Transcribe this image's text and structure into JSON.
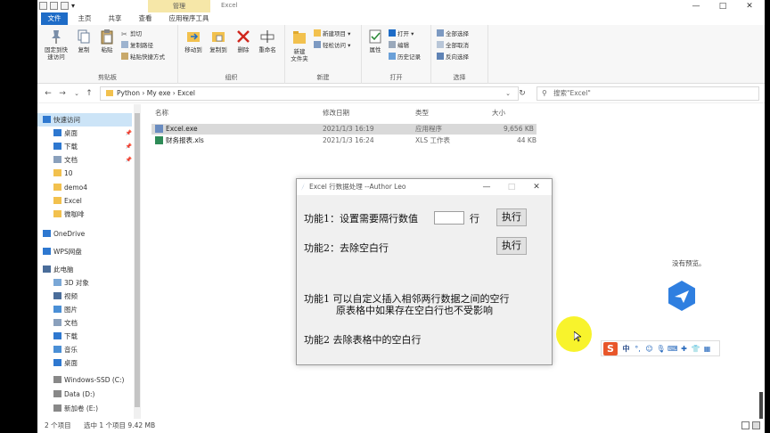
{
  "window": {
    "title": "Excel",
    "manage_tab": "管理",
    "controls": [
      "—",
      "□",
      "✕"
    ]
  },
  "ribbon_tabs": [
    {
      "label": "文件",
      "active": true
    },
    {
      "label": "主页",
      "active": false
    },
    {
      "label": "共享",
      "active": false
    },
    {
      "label": "查看",
      "active": false
    },
    {
      "label": "应用程序工具",
      "active": false
    }
  ],
  "ribbon": {
    "clipboard": {
      "label": "剪贴板",
      "pin_label": "固定到快\n速访问",
      "copy_label": "复制",
      "paste_label": "粘贴",
      "cut_label": "剪切",
      "copy_path_label": "复制路径",
      "paste_shortcut_label": "粘贴快捷方式"
    },
    "organize": {
      "label": "组织",
      "move_label": "移动到",
      "copy_to_label": "复制到",
      "delete_label": "删除",
      "rename_label": "重命名"
    },
    "new": {
      "label": "新建",
      "new_folder_label": "新建\n文件夹",
      "new_item_label": "新建项目",
      "easy_access_label": "轻松访问"
    },
    "open": {
      "label": "打开",
      "properties_label": "属性",
      "open_label": "打开",
      "edit_label": "编辑",
      "history_label": "历史记录"
    },
    "select": {
      "label": "选择",
      "select_all_label": "全部选择",
      "select_none_label": "全部取消",
      "invert_label": "反向选择"
    }
  },
  "address": {
    "path": "Python  ›  My exe  ›  Excel",
    "search_placeholder": "搜索\"Excel\""
  },
  "nav": {
    "items": [
      {
        "label": "快速访问",
        "icon": "star-icon",
        "pinned": false,
        "selected": true
      },
      {
        "label": "桌面",
        "icon": "desktop-icon",
        "pinned": true,
        "selected": false
      },
      {
        "label": "下载",
        "icon": "download-icon",
        "pinned": true,
        "selected": false
      },
      {
        "label": "文档",
        "icon": "document-icon",
        "pinned": true,
        "selected": false
      },
      {
        "label": "10",
        "icon": "folder-icon",
        "pinned": false,
        "selected": false
      },
      {
        "label": "demo4",
        "icon": "folder-icon",
        "pinned": false,
        "selected": false
      },
      {
        "label": "Excel",
        "icon": "folder-icon",
        "pinned": false,
        "selected": false
      },
      {
        "label": "微咖啡",
        "icon": "folder-icon",
        "pinned": false,
        "selected": false
      },
      {
        "label": "OneDrive",
        "icon": "cloud-icon",
        "pinned": false,
        "selected": false
      },
      {
        "label": "WPS网盘",
        "icon": "cloud-icon",
        "pinned": false,
        "selected": false
      },
      {
        "label": "此电脑",
        "icon": "computer-icon",
        "pinned": false,
        "selected": false
      },
      {
        "label": "3D 对象",
        "icon": "cube-icon",
        "pinned": false,
        "selected": false
      },
      {
        "label": "视频",
        "icon": "video-icon",
        "pinned": false,
        "selected": false
      },
      {
        "label": "图片",
        "icon": "picture-icon",
        "pinned": false,
        "selected": false
      },
      {
        "label": "文档",
        "icon": "document-icon",
        "pinned": false,
        "selected": false
      },
      {
        "label": "下载",
        "icon": "download-icon",
        "pinned": false,
        "selected": false
      },
      {
        "label": "音乐",
        "icon": "music-icon",
        "pinned": false,
        "selected": false
      },
      {
        "label": "桌面",
        "icon": "desktop-icon",
        "pinned": false,
        "selected": false
      },
      {
        "label": "Windows-SSD (C:)",
        "icon": "drive-icon",
        "pinned": false,
        "selected": false
      },
      {
        "label": "Data (D:)",
        "icon": "drive-icon",
        "pinned": false,
        "selected": false
      },
      {
        "label": "新加卷 (E:)",
        "icon": "drive-icon",
        "pinned": false,
        "selected": false
      }
    ]
  },
  "files": {
    "headers": {
      "name": "名称",
      "modified": "修改日期",
      "type": "类型",
      "size": "大小"
    },
    "rows": [
      {
        "name": "Excel.exe",
        "modified": "2021/1/3 16:19",
        "type": "应用程序",
        "size": "9,656 KB",
        "selected": true
      },
      {
        "name": "财务报表.xls",
        "modified": "2021/1/3 16:24",
        "type": "XLS 工作表",
        "size": "44 KB",
        "selected": false
      }
    ]
  },
  "status": {
    "item_count": "2 个项目",
    "selection": "选中 1 个项目  9.42 MB"
  },
  "dialog": {
    "title": "Excel 行数据处理    --Author   Leo",
    "controls": [
      "—",
      "□",
      "✕"
    ],
    "func1_label": "功能1：设置需要隔行数值",
    "func1_entry_value": "",
    "func1_unit": "行",
    "func1_button": "执行",
    "func2_label": "功能2：去除空白行",
    "func2_button": "执行",
    "desc1_line1": "功能1  可以自定义插入相邻两行数据之间的空行",
    "desc1_line2": "原表格中如果存在空白行也不受影响",
    "desc2": "功能2  去除表格中的空白行"
  },
  "preview": {
    "no_preview_text": "没有预览。"
  },
  "ime": {
    "logo_letter": "S",
    "mode": "中"
  }
}
